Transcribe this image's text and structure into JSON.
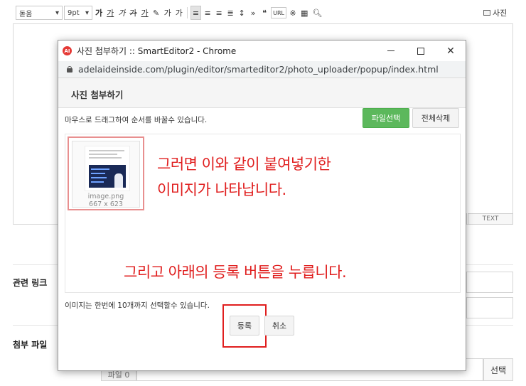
{
  "editor": {
    "font_family": "돋움",
    "font_size": "9pt",
    "format_buttons": [
      "가",
      "가",
      "가",
      "가",
      "가",
      "가",
      "가"
    ],
    "quote_icon": "❝",
    "url_label": "URL",
    "photo_label": "사진",
    "text_mode_label": "TEXT"
  },
  "background_form": {
    "related_link_label": "관련 링크",
    "attachment_label": "첨부 파일",
    "file_label": "파일 0",
    "select_label": "선택"
  },
  "popup": {
    "window_title": "사진 첨부하기 :: SmartEditor2 - Chrome",
    "app_icon_text": "AI",
    "url": "adelaideinside.com/plugin/editor/smarteditor2/photo_uploader/popup/index.html",
    "heading": "사진 첨부하기",
    "drag_hint": "마우스로 드래그하여 순서를 바꿀수 있습니다.",
    "file_select_label": "파일선택",
    "delete_all_label": "전체삭제",
    "thumbnail": {
      "filename": "image.png",
      "dimensions": "667 x 623"
    },
    "limit_text": "이미지는 한번에 10개까지 선택할수 있습니다.",
    "register_label": "등록",
    "cancel_label": "취소"
  },
  "annotations": {
    "line1": "그러면 이와 같이 붙여넣기한",
    "line2": "이미지가 나타납니다.",
    "line3": "그리고 아래의 등록 버튼을 누릅니다."
  },
  "colors": {
    "annotation_red": "#e01e1e",
    "file_select_green": "#5cb85c",
    "thumbnail_highlight": "#e88f8f"
  }
}
